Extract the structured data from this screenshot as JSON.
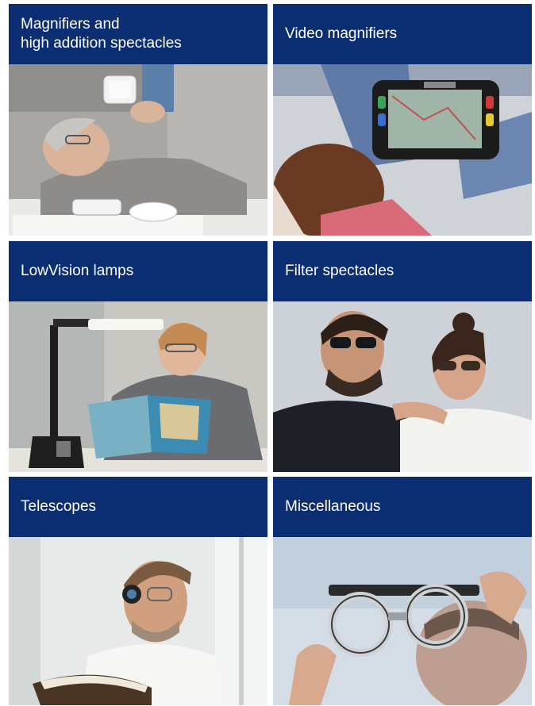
{
  "tiles": [
    {
      "title": "Magnifiers and\nhigh addition spectacles",
      "image": "person-with-hand-magnifier-photo"
    },
    {
      "title": "Video magnifiers",
      "image": "video-magnifier-device-photo"
    },
    {
      "title": "LowVision lamps",
      "image": "reading-lamp-photo"
    },
    {
      "title": "Filter spectacles",
      "image": "filter-glasses-couple-photo"
    },
    {
      "title": "Telescopes",
      "image": "telescope-glasses-reader-photo"
    },
    {
      "title": "Miscellaneous",
      "image": "trial-frame-photo"
    }
  ],
  "colors": {
    "header_bg": "#0b2e72",
    "header_text": "#ffffff"
  }
}
